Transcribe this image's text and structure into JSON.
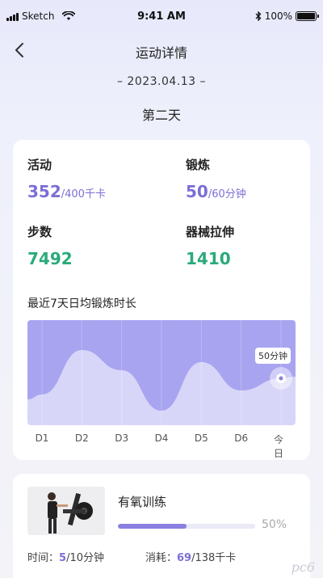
{
  "status_bar": {
    "carrier": "Sketch",
    "time": "9:41 AM",
    "battery": "100%"
  },
  "header": {
    "title": "运动详情",
    "date": "– 2023.04.13 –",
    "day": "第二天"
  },
  "stats": {
    "activity": {
      "label": "活动",
      "value": "352",
      "unit": "/400千卡"
    },
    "exercise": {
      "label": "锻炼",
      "value": "50",
      "unit": "/60分钟"
    },
    "steps": {
      "label": "步数",
      "value": "7492"
    },
    "stretch": {
      "label": "器械拉伸",
      "value": "1410"
    }
  },
  "chart_title": "最近7天日均锻炼时长",
  "chart_data": {
    "type": "area",
    "categories": [
      "D1",
      "D2",
      "D3",
      "D4",
      "D5",
      "D6",
      "今日"
    ],
    "values": [
      30,
      85,
      60,
      10,
      70,
      35,
      50
    ],
    "ylim": [
      0,
      100
    ],
    "grid": "vertical",
    "annotation": "50分钟",
    "fill_color": "#a9a4f0",
    "area_color": "#ffffff"
  },
  "workout": {
    "name": "有氧训练",
    "progress": 0.5,
    "progress_label": "50%",
    "time_label": "时间：",
    "time_value": "5",
    "time_unit": "/10分钟",
    "consume_label": "消耗：",
    "consume_value": "69",
    "consume_unit": "/138千卡"
  },
  "watermark": "pc6"
}
